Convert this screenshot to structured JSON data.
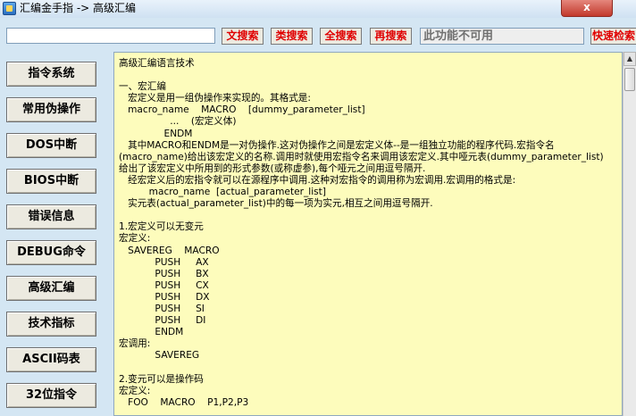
{
  "window": {
    "title": "汇编金手指 -> 高级汇编",
    "close_label": "x"
  },
  "toolbar": {
    "search_value": "",
    "search_placeholder": "",
    "buttons": [
      "文搜索",
      "类搜索",
      "全搜索",
      "再搜索"
    ],
    "disabled_text": "此功能不可用",
    "quick_search": "快速检索"
  },
  "sidebar": {
    "items": [
      "指令系统",
      "常用伪操作",
      "DOS中断",
      "BIOS中断",
      "错误信息",
      "DEBUG命令",
      "高级汇编",
      "技术指标",
      "ASCII码表",
      "32位指令"
    ]
  },
  "content": {
    "text": "高级汇编语言技术\n\n一、宏汇编\n   宏定义是用一组伪操作来实现的。其格式是:\n   macro_name    MACRO    [dummy_parameter_list]\n                 ...    (宏定义体)\n               ENDM\n   其中MACRO和ENDM是一对伪操作.这对伪操作之间是宏定义体--是一组独立功能的程序代码.宏指令名\n(macro_name)给出该宏定义的名称.调用时就使用宏指令名来调用该宏定义.其中哑元表(dummy_parameter_list)\n给出了该宏定义中所用到的形式参数(或称虚参),每个哑元之间用逗号隔开.\n   经宏定义后的宏指令就可以在源程序中调用.这种对宏指令的调用称为宏调用.宏调用的格式是:\n          macro_name  [actual_parameter_list]\n   实元表(actual_parameter_list)中的每一项为实元,相互之间用逗号隔开.\n\n1.宏定义可以无变元\n宏定义:\n   SAVEREG    MACRO\n            PUSH     AX\n            PUSH     BX\n            PUSH     CX\n            PUSH     DX\n            PUSH     SI\n            PUSH     DI\n            ENDM\n宏调用:\n            SAVEREG\n\n2.变元可以是操作码\n宏定义:\n   FOO    MACRO    P1,P2,P3"
  },
  "scrollbar": {
    "up_icon": "scroll-up-arrow",
    "position": 0.0
  },
  "colors": {
    "accent_red": "#e00000",
    "content_bg": "#fdfcbc",
    "window_bg": "#d4e6f3"
  }
}
